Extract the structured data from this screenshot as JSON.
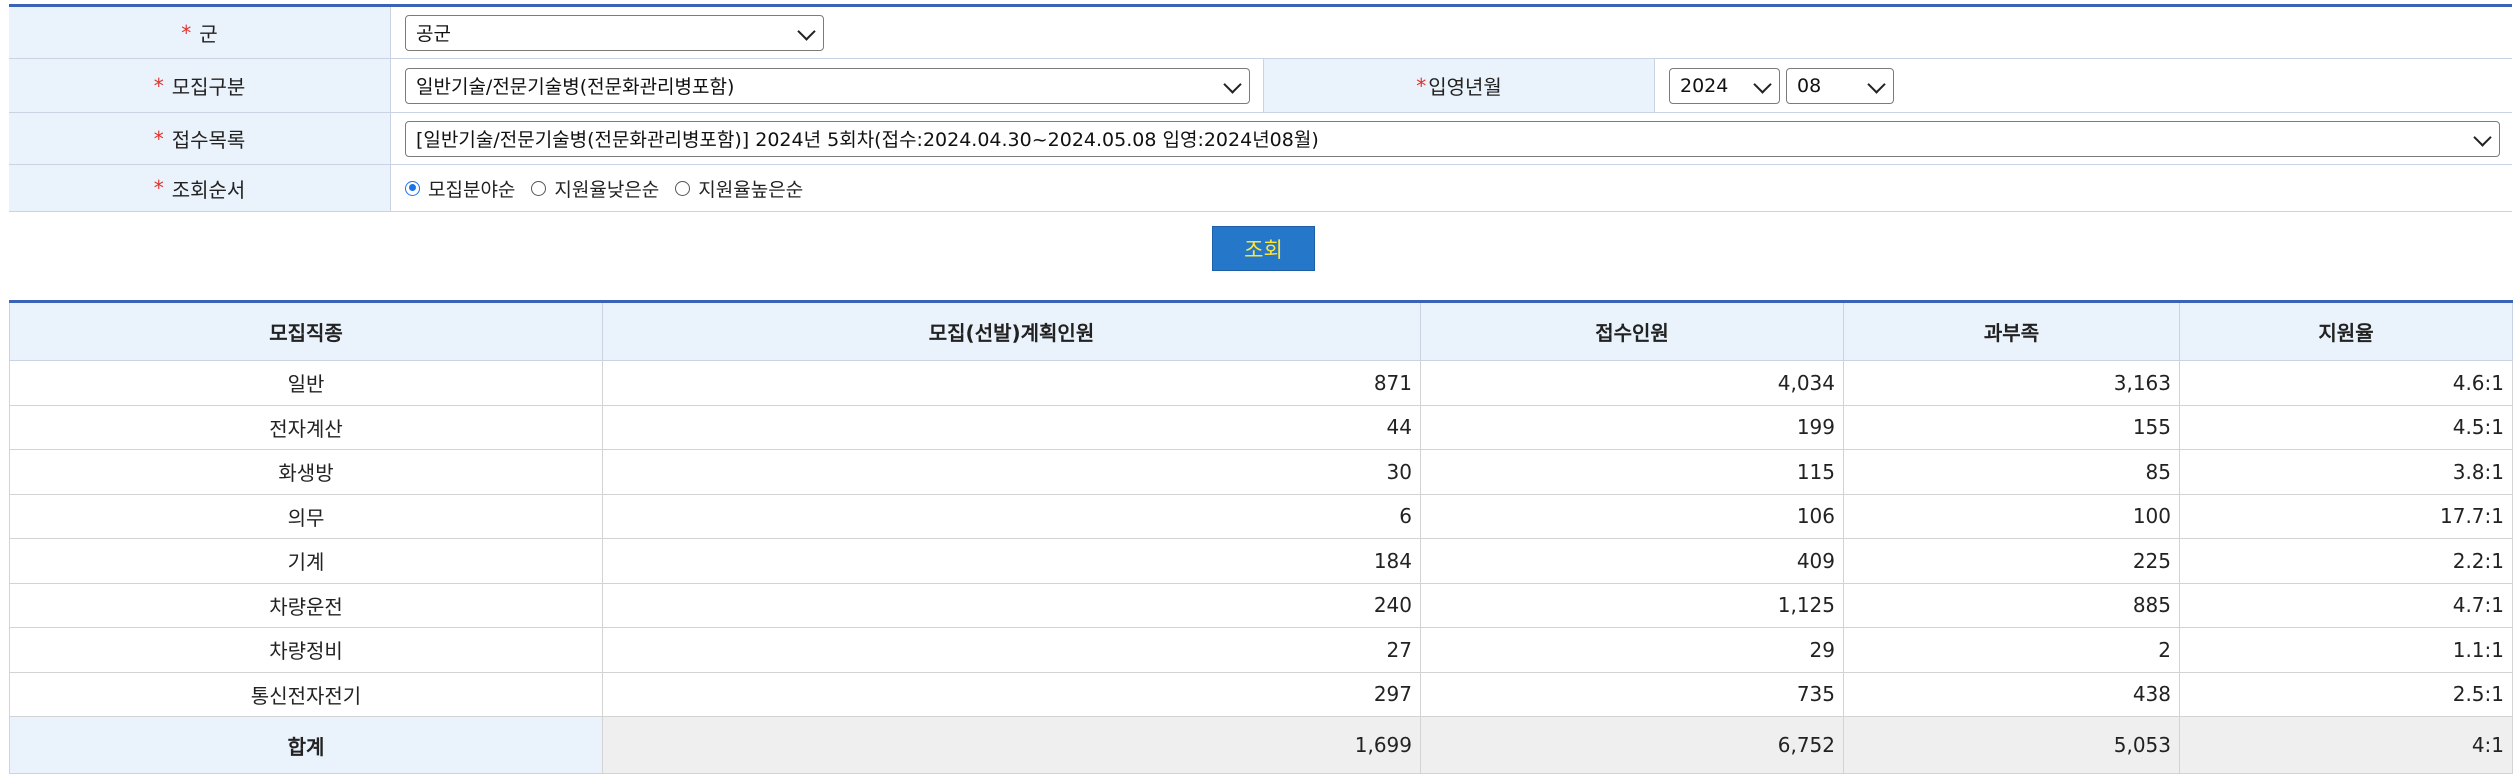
{
  "form": {
    "branch": {
      "label": "군",
      "value": "공군"
    },
    "recruit_type": {
      "label": "모집구분",
      "value": "일반기술/전문기술병(전문화관리병포함)"
    },
    "enlist_month": {
      "label": "입영년월",
      "year": "2024",
      "month": "08"
    },
    "receipt_list": {
      "label": "접수목록",
      "value": "[일반기술/전문기술병(전문화관리병포함)] 2024년 5회차(접수:2024.04.30~2024.05.08 입영:2024년08월)"
    },
    "sort_order": {
      "label": "조회순서",
      "options": [
        "모집분야순",
        "지원율낮은순",
        "지원율높은순"
      ],
      "selected": "모집분야순"
    },
    "required_mark": "*"
  },
  "search_button": {
    "label": "조회"
  },
  "table": {
    "headers": [
      "모집직종",
      "모집(선발)계획인원",
      "접수인원",
      "과부족",
      "지원율"
    ],
    "rows": [
      [
        "일반",
        "871",
        "4,034",
        "3,163",
        "4.6:1"
      ],
      [
        "전자계산",
        "44",
        "199",
        "155",
        "4.5:1"
      ],
      [
        "화생방",
        "30",
        "115",
        "85",
        "3.8:1"
      ],
      [
        "의무",
        "6",
        "106",
        "100",
        "17.7:1"
      ],
      [
        "기계",
        "184",
        "409",
        "225",
        "2.2:1"
      ],
      [
        "차량운전",
        "240",
        "1,125",
        "885",
        "4.7:1"
      ],
      [
        "차량정비",
        "27",
        "29",
        "2",
        "1.1:1"
      ],
      [
        "통신전자전기",
        "297",
        "735",
        "438",
        "2.5:1"
      ]
    ],
    "total": [
      "합계",
      "1,699",
      "6,752",
      "5,053",
      "4:1"
    ]
  },
  "colors": {
    "accent_border": "#3a63b8",
    "label_bg": "#eaf2fc",
    "button_bg": "#2477c9",
    "button_text": "#ffe43a",
    "required": "#e0312a"
  }
}
